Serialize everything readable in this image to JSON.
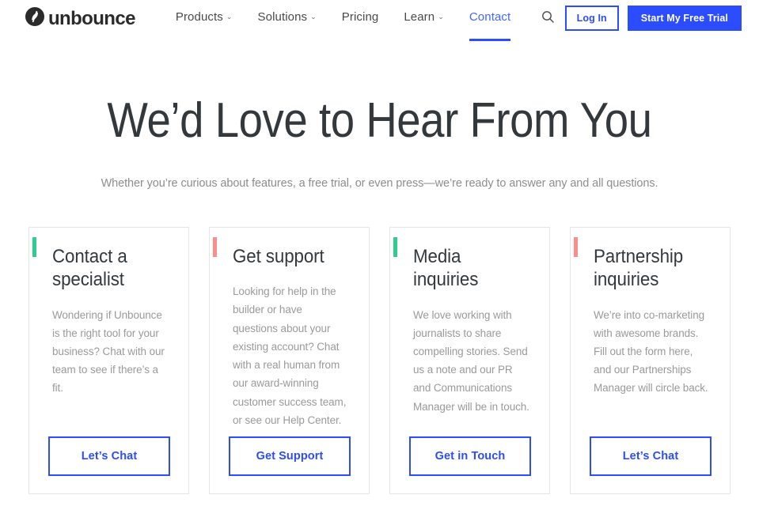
{
  "brand": {
    "logo_text": "unbounce",
    "logo_icon": "unbounce-circle-slash-logo",
    "primary_color": "#2b4cff",
    "link_color": "#4466ff"
  },
  "header": {
    "nav_items": [
      {
        "label": "Products",
        "has_dropdown": true,
        "active": false,
        "caret": "⌄"
      },
      {
        "label": "Solutions",
        "has_dropdown": true,
        "active": false,
        "caret": "⌄"
      },
      {
        "label": "Pricing",
        "has_dropdown": false,
        "active": false,
        "caret": ""
      },
      {
        "label": "Learn",
        "has_dropdown": true,
        "active": false,
        "caret": "⌄"
      },
      {
        "label": "Contact",
        "has_dropdown": false,
        "active": true,
        "caret": ""
      }
    ],
    "search_icon": "search-icon",
    "login_label": "Log In",
    "trial_label": "Start My Free Trial"
  },
  "hero": {
    "title": "We’d Love to Hear From You",
    "subtitle": "Whether you’re curious about features, a free trial, or even press—we’re ready to answer any and all questions."
  },
  "cards": [
    {
      "accent_color": "#2ecc8f",
      "title": "Contact a specialist",
      "body": "Wondering if Unbounce is the right tool for your business? Chat with our team to see if there’s a fit.",
      "button_label": "Let’s Chat"
    },
    {
      "accent_color": "#fb8d8d",
      "title": "Get support",
      "body": "Looking for help in the builder or have questions about your existing account? Chat with a real human from our award-winning customer success team, or see our Help Center.",
      "button_label": "Get Support"
    },
    {
      "accent_color": "#2ecc8f",
      "title": "Media inquiries",
      "body": "We love working with journalists to share compelling stories. Send us a note and our PR and Communications Manager will be in touch.",
      "button_label": "Get in Touch"
    },
    {
      "accent_color": "#fb8d8d",
      "title": "Partnership inquiries",
      "body": "We’re into co-marketing with awesome brands. Fill out the form here, and our Partnerships Manager will circle back.",
      "button_label": "Let’s Chat"
    }
  ]
}
